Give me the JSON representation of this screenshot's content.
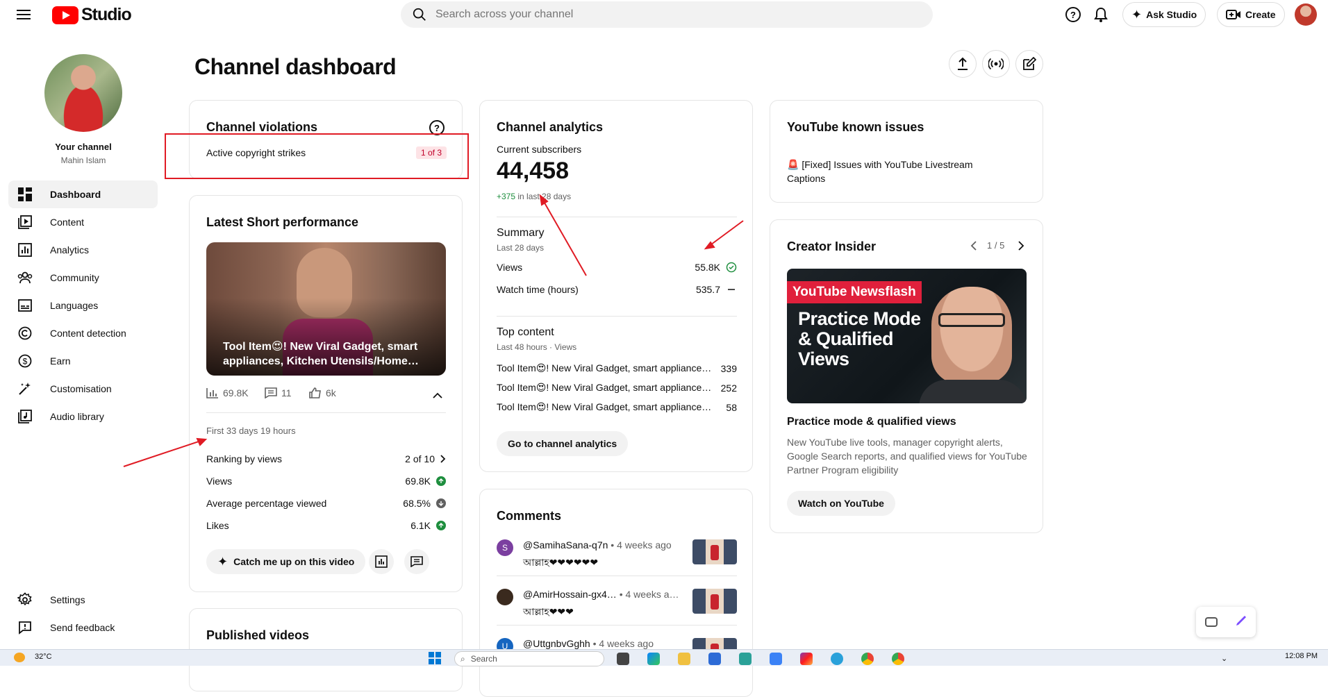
{
  "topbar": {
    "logo_text": "Studio",
    "search_placeholder": "Search across your channel",
    "ask_studio_label": "Ask Studio",
    "create_label": "Create"
  },
  "sidebar": {
    "channel_title": "Your channel",
    "channel_name": "Mahin Islam",
    "items": [
      {
        "label": "Dashboard",
        "icon": "dashboard-icon"
      },
      {
        "label": "Content",
        "icon": "content-icon"
      },
      {
        "label": "Analytics",
        "icon": "analytics-icon"
      },
      {
        "label": "Community",
        "icon": "community-icon"
      },
      {
        "label": "Languages",
        "icon": "languages-icon"
      },
      {
        "label": "Content detection",
        "icon": "copyright-icon"
      },
      {
        "label": "Earn",
        "icon": "dollar-icon"
      },
      {
        "label": "Customisation",
        "icon": "magic-wand-icon"
      },
      {
        "label": "Audio library",
        "icon": "audio-library-icon"
      }
    ],
    "settings_label": "Settings",
    "feedback_label": "Send feedback"
  },
  "main": {
    "page_title": "Channel dashboard",
    "violations": {
      "title": "Channel violations",
      "item_label": "Active copyright strikes",
      "item_badge": "1 of 3"
    },
    "short_perf": {
      "title": "Latest Short performance",
      "video_title": "Tool Item😍! New Viral Gadget, smart appliances, Kitchen Utensils/Home…",
      "views_stat": "69.8K",
      "comments_stat": "11",
      "likes_stat": "6k",
      "period": "First 33 days 19 hours",
      "rows": [
        {
          "label": "Ranking by views",
          "value": "2 of 10"
        },
        {
          "label": "Views",
          "value": "69.8K"
        },
        {
          "label": "Average percentage viewed",
          "value": "68.5%"
        },
        {
          "label": "Likes",
          "value": "6.1K"
        }
      ],
      "catch_up_label": "Catch me up on this video"
    },
    "published": {
      "title": "Published videos"
    },
    "analytics": {
      "title": "Channel analytics",
      "subs_label": "Current subscribers",
      "subs_value": "44,458",
      "subs_delta": "+375",
      "subs_delta_suffix": " in last 28 days",
      "summary_title": "Summary",
      "summary_period": "Last 28 days",
      "summary_rows": [
        {
          "label": "Views",
          "value": "55.8K"
        },
        {
          "label": "Watch time (hours)",
          "value": "535.7"
        }
      ],
      "top_title": "Top content",
      "top_period": "Last 48 hours · Views",
      "top_rows": [
        {
          "label": "Tool Item😍! New Viral Gadget, smart appliance…",
          "value": "339"
        },
        {
          "label": "Tool Item😍! New Viral Gadget, smart appliance…",
          "value": "252"
        },
        {
          "label": "Tool Item😍! New Viral Gadget, smart appliance…",
          "value": "58"
        }
      ],
      "go_btn": "Go to channel analytics"
    },
    "comments": {
      "title": "Comments",
      "items": [
        {
          "avatar_letter": "S",
          "avatar_color": "#7b3fa0",
          "user": "@SamihaSana-q7n",
          "time": "• 4 weeks ago",
          "text": "আল্লাহ❤❤❤❤❤❤"
        },
        {
          "avatar_letter": "",
          "avatar_color": "#3a2a1e",
          "user": "@AmirHossain-gx4…",
          "time": "• 4 weeks a…",
          "text": "আল্লাহ❤❤❤"
        },
        {
          "avatar_letter": "U",
          "avatar_color": "#1565c0",
          "user": "@UttgnbvGghh",
          "time": "• 4 weeks ago",
          "text": ""
        }
      ]
    },
    "known_issues": {
      "title": "YouTube known issues",
      "item": "🚨 [Fixed] Issues with YouTube Livestream Captions"
    },
    "creator_insider": {
      "title": "Creator Insider",
      "pager": "1 / 5",
      "thumb_badge": "YouTube Newsflash",
      "thumb_headline": "Practice Mode & Qualified Views",
      "video_title": "Practice mode & qualified views",
      "desc": "New YouTube live tools, manager copyright alerts, Google Search reports, and qualified views for YouTube Partner Program eligibility",
      "watch_btn": "Watch on YouTube"
    }
  },
  "taskbar": {
    "weather": "32°C",
    "search_placeholder": "Search",
    "time": "12:08 PM"
  },
  "colors": {
    "brand_red": "#ff0000",
    "positive_green": "#1e8e3e",
    "annotation_red": "#e01b24"
  }
}
